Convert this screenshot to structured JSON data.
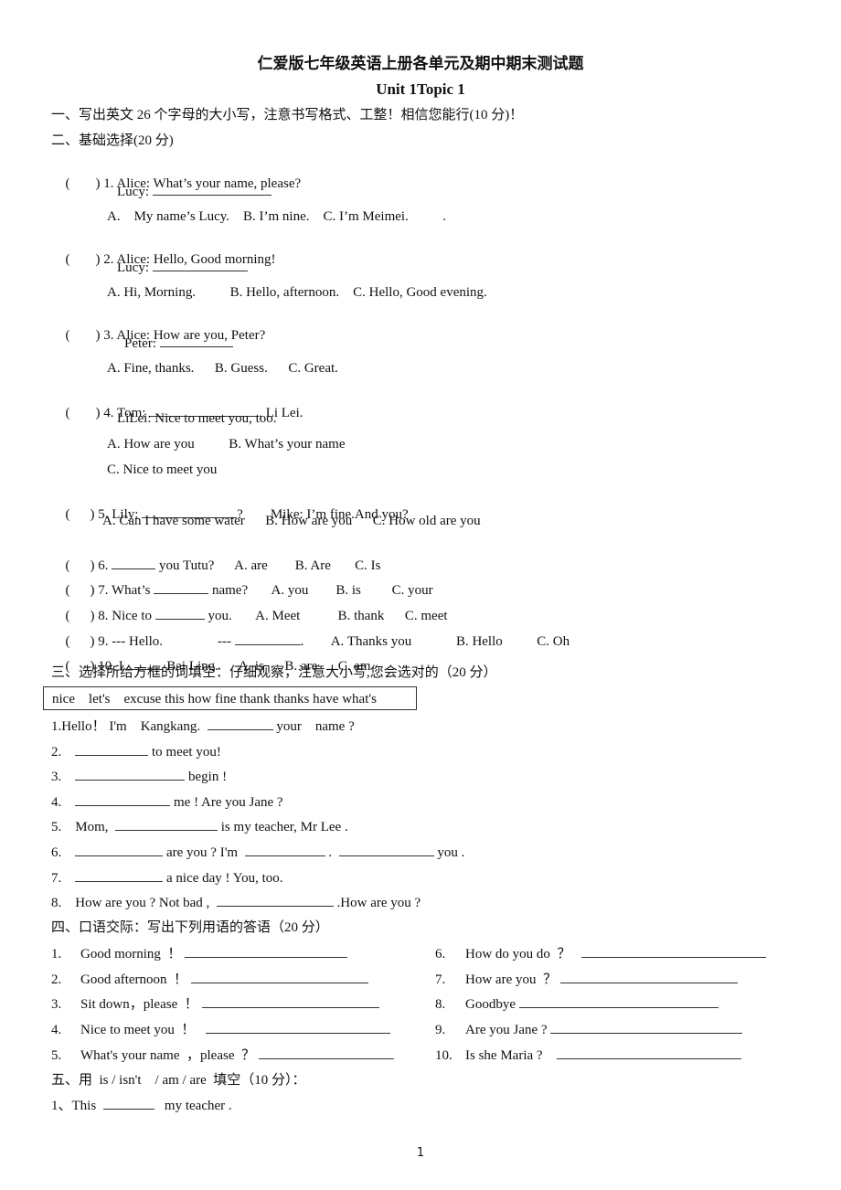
{
  "title": "仁爱版七年级英语上册各单元及期中期末测试题",
  "subtitle": "Unit 1Topic 1",
  "section1": {
    "heading": "一、写出英文 26 个字母的大小写，注意书写格式、工整！相信您能行(10 分)！"
  },
  "section2": {
    "heading": "二、基础选择(20 分)",
    "paren": "(",
    "paren_close": ")",
    "q1": {
      "stem": "1. Alice: What’s your name, please?",
      "reply": "Lucy:",
      "options": "A.    My name’s Lucy.    B. I’m nine.    C. I’m Meimei.          ."
    },
    "q2": {
      "stem": "2. Alice: Hello, Good morning!",
      "reply": "Lucy:",
      "options": "A. Hi, Morning.          B. Hello, afternoon.    C. Hello, Good evening."
    },
    "q3": {
      "stem": "3. Alice: How are you, Peter?",
      "reply": "Peter:",
      "options": "A. Fine, thanks.      B. Guess.      C. Great."
    },
    "q4": {
      "stem_pre": "4. Tom:",
      "stem_post": ", Li Lei.",
      "reply": "LiLei: Nice to meet you, too.",
      "options1": "A. How are you          B. What’s your name",
      "options2": "C. Nice to meet you"
    },
    "q5": {
      "stem_pre": "5. Lily:",
      "stem_post": "?        Mike: I’m fine.And you?",
      "options": "A. Can I have some water      B. How are you      C. How old are you"
    },
    "q6": {
      "pre": "6.",
      "post": " you Tutu?      A. are        B. Are       C. Is"
    },
    "q7": {
      "pre": "7. What’s",
      "post": " name?       A. you        B. is         C. your"
    },
    "q8": {
      "pre": "8. Nice to",
      "post": " you.       A. Meet           B. thank      C. meet"
    },
    "q9": {
      "pre": "9. --- Hello.                ---",
      "post": ".        A. Thanks you             B. Hello          C. Oh"
    },
    "q10": {
      "pre": "10. I",
      "post": " Bai Ling.      A. is      B. are      C. am"
    }
  },
  "section3": {
    "heading": "三、选择所给方框的词填空：仔细观察，注意大小写,您会选对的（20 分）",
    "word_box": "nice    let's    excuse this how fine thank thanks have what's",
    "items": [
      {
        "pre": "1.Hello！ I'm    Kangkang.",
        "post": " your    name ?"
      },
      {
        "pre": "2.",
        "post": " to meet you!"
      },
      {
        "pre": "3.",
        "post": " begin !"
      },
      {
        "pre": "4.",
        "post": " me ! Are you Jane ?"
      },
      {
        "pre": "5.    Mom,",
        "post": " is my teacher, Mr Lee ."
      },
      {
        "pre": "6.",
        "mid1": " are you ? I'm",
        "mid2": " .",
        "post": " you ."
      },
      {
        "pre": "7.",
        "post": " a nice day ! You, too."
      },
      {
        "pre": "8.    How are you ? Not bad ,",
        "post": " .How are you ?"
      }
    ]
  },
  "section4": {
    "heading": "四、口语交际：写出下列用语的答语（20 分）",
    "left": [
      {
        "num": "1.",
        "text": "Good morning  ！"
      },
      {
        "num": "2.",
        "text": "Good afternoon  ！"
      },
      {
        "num": "3.",
        "text": "Sit down，please  ！"
      },
      {
        "num": "4.",
        "text": "Nice to meet you  ！"
      },
      {
        "num": "5.",
        "text": "What's your name  ，please  ？"
      }
    ],
    "right": [
      {
        "num": "6.",
        "text": "How do you do  ？"
      },
      {
        "num": "7.",
        "text": "How are you  ？"
      },
      {
        "num": "8.",
        "text": "Goodbye"
      },
      {
        "num": "9.",
        "text": "Are you Jane ?"
      },
      {
        "num": "10.",
        "text": "Is she Maria ?"
      }
    ]
  },
  "section5": {
    "heading": "五、用  is / isn't    / am / are  填空（10 分）：",
    "items": [
      {
        "pre": "1、This",
        "post": " my teacher ."
      }
    ]
  },
  "page_number": "1"
}
